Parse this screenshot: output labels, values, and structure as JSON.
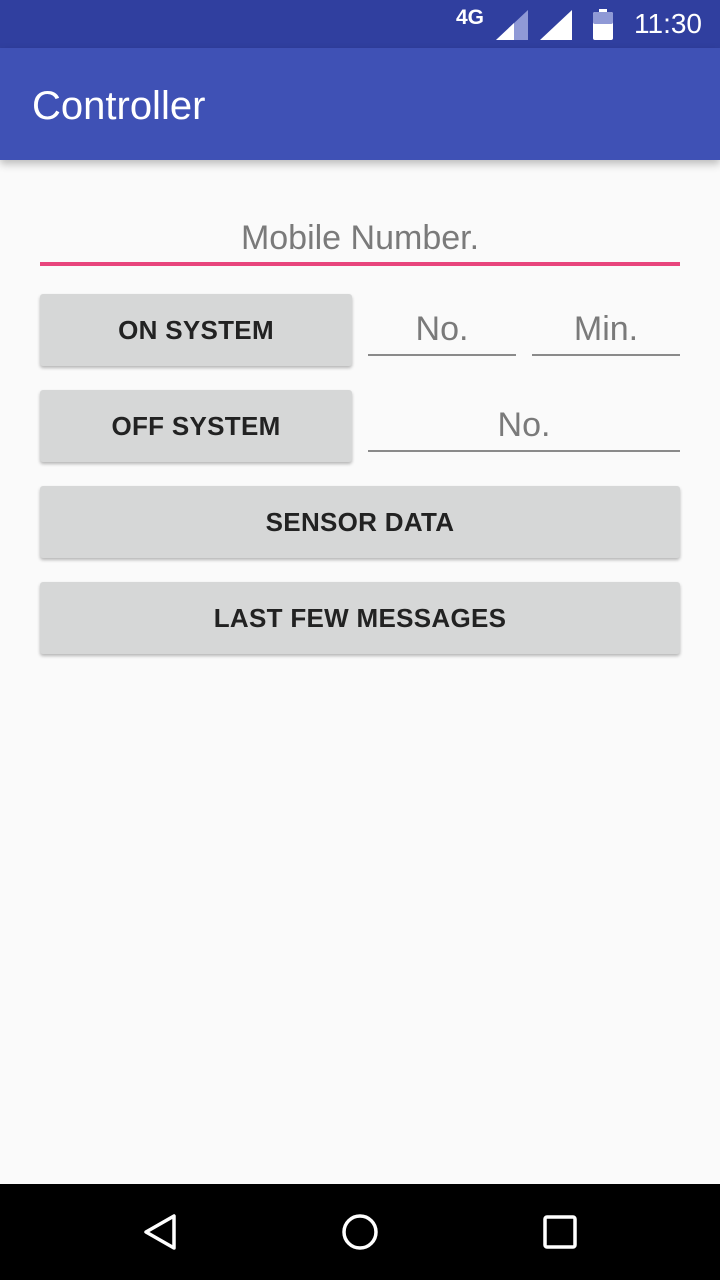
{
  "status_bar": {
    "network": "4G",
    "battery_level": "55",
    "time": "11:30",
    "icons": [
      "signal-icon",
      "wifi-signal-icon",
      "battery-icon"
    ]
  },
  "app_bar": {
    "title": "Controller",
    "color": "#3f51b5"
  },
  "form": {
    "mobile_placeholder": "Mobile Number.",
    "on_system": {
      "label": "ON SYSTEM",
      "number_placeholder": "No.",
      "minutes_placeholder": "Min."
    },
    "off_system": {
      "label": "OFF SYSTEM",
      "number_placeholder": "No."
    },
    "sensor_data_label": "SENSOR DATA",
    "last_messages_label": "LAST FEW MESSAGES",
    "accent_color": "#e8457c"
  },
  "nav_bar": {
    "icons": [
      "back-icon",
      "home-icon",
      "recents-icon"
    ]
  }
}
